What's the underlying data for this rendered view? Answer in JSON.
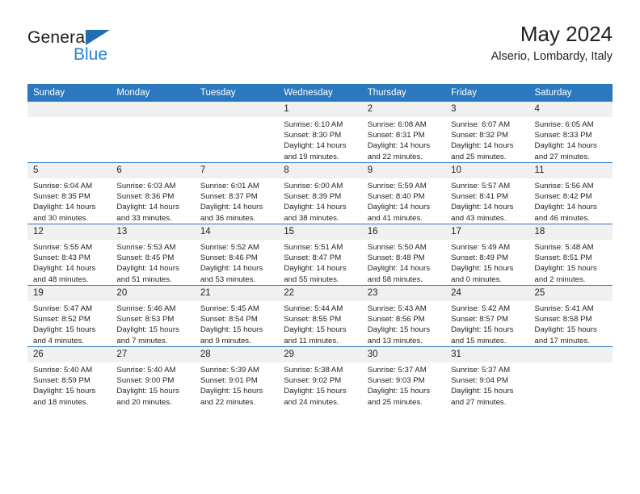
{
  "brand": {
    "name_top": "General",
    "name_bottom": "Blue",
    "accent_color": "#2585d3",
    "triangle_color": "#1f6fb2",
    "logo_icon": "general-blue-logo"
  },
  "header": {
    "title": "May 2024",
    "subtitle": "Alserio, Lombardy, Italy"
  },
  "theme": {
    "header_row_color": "#2c78be",
    "day_strip_color": "#f0f0f0",
    "text_color": "#231f20"
  },
  "weekdays": [
    "Sunday",
    "Monday",
    "Tuesday",
    "Wednesday",
    "Thursday",
    "Friday",
    "Saturday"
  ],
  "labels": {
    "sunrise": "Sunrise:",
    "sunset": "Sunset:",
    "daylight": "Daylight:"
  },
  "weeks": [
    [
      {
        "day": "",
        "empty": true
      },
      {
        "day": "",
        "empty": true
      },
      {
        "day": "",
        "empty": true
      },
      {
        "day": "1",
        "sunrise": "Sunrise: 6:10 AM",
        "sunset": "Sunset: 8:30 PM",
        "daylight1": "Daylight: 14 hours",
        "daylight2": "and 19 minutes."
      },
      {
        "day": "2",
        "sunrise": "Sunrise: 6:08 AM",
        "sunset": "Sunset: 8:31 PM",
        "daylight1": "Daylight: 14 hours",
        "daylight2": "and 22 minutes."
      },
      {
        "day": "3",
        "sunrise": "Sunrise: 6:07 AM",
        "sunset": "Sunset: 8:32 PM",
        "daylight1": "Daylight: 14 hours",
        "daylight2": "and 25 minutes."
      },
      {
        "day": "4",
        "sunrise": "Sunrise: 6:05 AM",
        "sunset": "Sunset: 8:33 PM",
        "daylight1": "Daylight: 14 hours",
        "daylight2": "and 27 minutes."
      }
    ],
    [
      {
        "day": "5",
        "sunrise": "Sunrise: 6:04 AM",
        "sunset": "Sunset: 8:35 PM",
        "daylight1": "Daylight: 14 hours",
        "daylight2": "and 30 minutes."
      },
      {
        "day": "6",
        "sunrise": "Sunrise: 6:03 AM",
        "sunset": "Sunset: 8:36 PM",
        "daylight1": "Daylight: 14 hours",
        "daylight2": "and 33 minutes."
      },
      {
        "day": "7",
        "sunrise": "Sunrise: 6:01 AM",
        "sunset": "Sunset: 8:37 PM",
        "daylight1": "Daylight: 14 hours",
        "daylight2": "and 36 minutes."
      },
      {
        "day": "8",
        "sunrise": "Sunrise: 6:00 AM",
        "sunset": "Sunset: 8:39 PM",
        "daylight1": "Daylight: 14 hours",
        "daylight2": "and 38 minutes."
      },
      {
        "day": "9",
        "sunrise": "Sunrise: 5:59 AM",
        "sunset": "Sunset: 8:40 PM",
        "daylight1": "Daylight: 14 hours",
        "daylight2": "and 41 minutes."
      },
      {
        "day": "10",
        "sunrise": "Sunrise: 5:57 AM",
        "sunset": "Sunset: 8:41 PM",
        "daylight1": "Daylight: 14 hours",
        "daylight2": "and 43 minutes."
      },
      {
        "day": "11",
        "sunrise": "Sunrise: 5:56 AM",
        "sunset": "Sunset: 8:42 PM",
        "daylight1": "Daylight: 14 hours",
        "daylight2": "and 46 minutes."
      }
    ],
    [
      {
        "day": "12",
        "sunrise": "Sunrise: 5:55 AM",
        "sunset": "Sunset: 8:43 PM",
        "daylight1": "Daylight: 14 hours",
        "daylight2": "and 48 minutes."
      },
      {
        "day": "13",
        "sunrise": "Sunrise: 5:53 AM",
        "sunset": "Sunset: 8:45 PM",
        "daylight1": "Daylight: 14 hours",
        "daylight2": "and 51 minutes."
      },
      {
        "day": "14",
        "sunrise": "Sunrise: 5:52 AM",
        "sunset": "Sunset: 8:46 PM",
        "daylight1": "Daylight: 14 hours",
        "daylight2": "and 53 minutes."
      },
      {
        "day": "15",
        "sunrise": "Sunrise: 5:51 AM",
        "sunset": "Sunset: 8:47 PM",
        "daylight1": "Daylight: 14 hours",
        "daylight2": "and 55 minutes."
      },
      {
        "day": "16",
        "sunrise": "Sunrise: 5:50 AM",
        "sunset": "Sunset: 8:48 PM",
        "daylight1": "Daylight: 14 hours",
        "daylight2": "and 58 minutes."
      },
      {
        "day": "17",
        "sunrise": "Sunrise: 5:49 AM",
        "sunset": "Sunset: 8:49 PM",
        "daylight1": "Daylight: 15 hours",
        "daylight2": "and 0 minutes."
      },
      {
        "day": "18",
        "sunrise": "Sunrise: 5:48 AM",
        "sunset": "Sunset: 8:51 PM",
        "daylight1": "Daylight: 15 hours",
        "daylight2": "and 2 minutes."
      }
    ],
    [
      {
        "day": "19",
        "sunrise": "Sunrise: 5:47 AM",
        "sunset": "Sunset: 8:52 PM",
        "daylight1": "Daylight: 15 hours",
        "daylight2": "and 4 minutes."
      },
      {
        "day": "20",
        "sunrise": "Sunrise: 5:46 AM",
        "sunset": "Sunset: 8:53 PM",
        "daylight1": "Daylight: 15 hours",
        "daylight2": "and 7 minutes."
      },
      {
        "day": "21",
        "sunrise": "Sunrise: 5:45 AM",
        "sunset": "Sunset: 8:54 PM",
        "daylight1": "Daylight: 15 hours",
        "daylight2": "and 9 minutes."
      },
      {
        "day": "22",
        "sunrise": "Sunrise: 5:44 AM",
        "sunset": "Sunset: 8:55 PM",
        "daylight1": "Daylight: 15 hours",
        "daylight2": "and 11 minutes."
      },
      {
        "day": "23",
        "sunrise": "Sunrise: 5:43 AM",
        "sunset": "Sunset: 8:56 PM",
        "daylight1": "Daylight: 15 hours",
        "daylight2": "and 13 minutes."
      },
      {
        "day": "24",
        "sunrise": "Sunrise: 5:42 AM",
        "sunset": "Sunset: 8:57 PM",
        "daylight1": "Daylight: 15 hours",
        "daylight2": "and 15 minutes."
      },
      {
        "day": "25",
        "sunrise": "Sunrise: 5:41 AM",
        "sunset": "Sunset: 8:58 PM",
        "daylight1": "Daylight: 15 hours",
        "daylight2": "and 17 minutes."
      }
    ],
    [
      {
        "day": "26",
        "sunrise": "Sunrise: 5:40 AM",
        "sunset": "Sunset: 8:59 PM",
        "daylight1": "Daylight: 15 hours",
        "daylight2": "and 18 minutes."
      },
      {
        "day": "27",
        "sunrise": "Sunrise: 5:40 AM",
        "sunset": "Sunset: 9:00 PM",
        "daylight1": "Daylight: 15 hours",
        "daylight2": "and 20 minutes."
      },
      {
        "day": "28",
        "sunrise": "Sunrise: 5:39 AM",
        "sunset": "Sunset: 9:01 PM",
        "daylight1": "Daylight: 15 hours",
        "daylight2": "and 22 minutes."
      },
      {
        "day": "29",
        "sunrise": "Sunrise: 5:38 AM",
        "sunset": "Sunset: 9:02 PM",
        "daylight1": "Daylight: 15 hours",
        "daylight2": "and 24 minutes."
      },
      {
        "day": "30",
        "sunrise": "Sunrise: 5:37 AM",
        "sunset": "Sunset: 9:03 PM",
        "daylight1": "Daylight: 15 hours",
        "daylight2": "and 25 minutes."
      },
      {
        "day": "31",
        "sunrise": "Sunrise: 5:37 AM",
        "sunset": "Sunset: 9:04 PM",
        "daylight1": "Daylight: 15 hours",
        "daylight2": "and 27 minutes."
      },
      {
        "day": "",
        "empty": true
      }
    ]
  ]
}
